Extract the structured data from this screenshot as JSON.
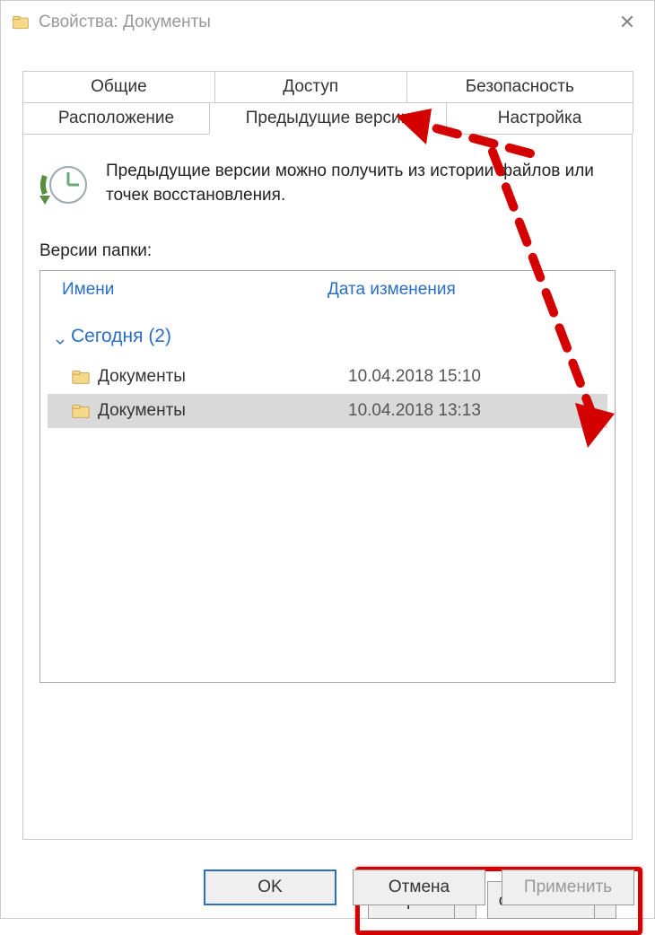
{
  "titlebar": {
    "title": "Свойства: Документы"
  },
  "tabs": {
    "row1": [
      "Общие",
      "Доступ",
      "Безопасность"
    ],
    "row2": [
      "Расположение",
      "Предыдущие версии",
      "Настройка"
    ],
    "selected": "Предыдущие версии"
  },
  "info": "Предыдущие версии можно получить из истории файлов или точек восстановления.",
  "sectionLabel": "Версии папки:",
  "listHeaders": {
    "name": "Имени",
    "date": "Дата изменения"
  },
  "group": {
    "label": "Сегодня (2)"
  },
  "rows": [
    {
      "name": "Документы",
      "date": "10.04.2018 15:10",
      "selected": false
    },
    {
      "name": "Документы",
      "date": "10.04.2018 13:13",
      "selected": true
    }
  ],
  "actions": {
    "open": "Открыть",
    "restore": "осстановит"
  },
  "dialog": {
    "ok": "OK",
    "cancel": "Отмена",
    "apply": "Применить"
  }
}
